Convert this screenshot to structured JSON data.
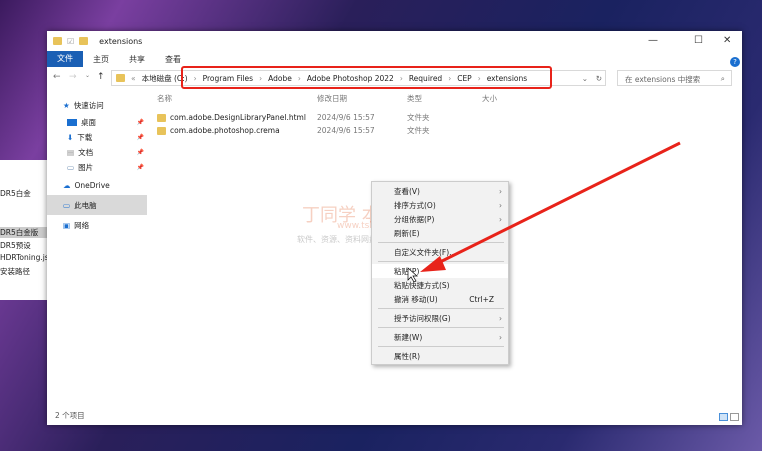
{
  "background_window": {
    "items": [
      "DR5白金",
      "DR5白金版",
      "DR5预设",
      "HDRToning.jsx",
      "安装路径"
    ]
  },
  "window": {
    "title": "extensions",
    "minimize": "—",
    "maximize": "☐",
    "close": "✕"
  },
  "ribbon": {
    "tabs": [
      "文件",
      "主页",
      "共享",
      "查看"
    ]
  },
  "address": {
    "root": "本地磁盘 (C:)",
    "crumbs": [
      "Program Files",
      "Adobe",
      "Adobe Photoshop 2022",
      "Required",
      "CEP",
      "extensions"
    ],
    "prefix": "«"
  },
  "search": {
    "placeholder": "在 extensions 中搜索"
  },
  "sidebar": {
    "items": [
      {
        "label": "快速访问"
      },
      {
        "label": "桌面"
      },
      {
        "label": "下载"
      },
      {
        "label": "文档"
      },
      {
        "label": "图片"
      },
      {
        "label": "OneDrive"
      },
      {
        "label": "此电脑"
      },
      {
        "label": "网络"
      }
    ]
  },
  "columns": [
    "名称",
    "修改日期",
    "类型",
    "大小"
  ],
  "files": [
    {
      "name": "com.adobe.DesignLibraryPanel.html",
      "date": "2024/9/6 15:57",
      "type": "文件夹"
    },
    {
      "name": "com.adobe.photoshop.crema",
      "date": "2024/9/6 15:57",
      "type": "文件夹"
    }
  ],
  "status": "2 个项目",
  "context_menu": {
    "items": [
      {
        "label": "查看(V)",
        "arrow": true
      },
      {
        "label": "排序方式(O)",
        "arrow": true
      },
      {
        "label": "分组依据(P)",
        "arrow": true
      },
      {
        "label": "刷新(E)"
      },
      {
        "label": "自定义文件夹(F)..."
      },
      {
        "label": "粘贴(P)"
      },
      {
        "label": "粘贴快捷方式(S)"
      },
      {
        "label": "撤消 移动(U)",
        "shortcut": "Ctrl+Z"
      },
      {
        "label": "授予访问权限(G)",
        "arrow": true
      },
      {
        "label": "新建(W)",
        "arrow": true
      },
      {
        "label": "属性(R)"
      }
    ]
  },
  "watermark": {
    "line1": "丁同学  本",
    "line2": "www.tsh...net",
    "line3": "软件、资源、资料网盘直接分享下载"
  }
}
